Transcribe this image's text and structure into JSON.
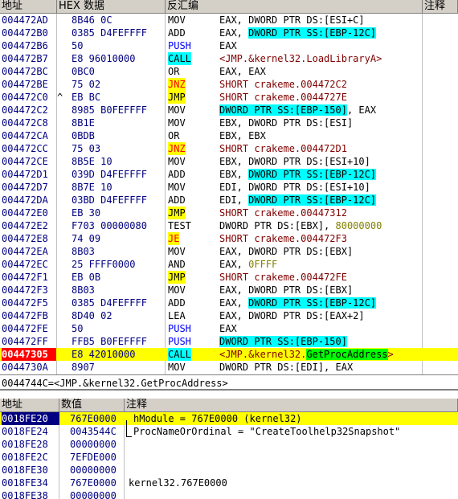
{
  "cpu": {
    "headers": {
      "address": "地址",
      "hex": "HEX 数据",
      "disasm": "反汇编",
      "comment": "注释"
    },
    "rows": [
      {
        "addr": "004472AD",
        "mark": "",
        "hex": "8B46 0C",
        "mn": "MOV",
        "op": [
          {
            "t": "EAX, DWORD PTR DS:[ESI+C]"
          }
        ]
      },
      {
        "addr": "004472B0",
        "mark": "",
        "hex": "0385 D4FEFFFF",
        "mn": "ADD",
        "op": [
          {
            "t": "EAX, "
          },
          {
            "t": "DWORD PTR SS:[EBP-12C]",
            "c": "cy"
          }
        ]
      },
      {
        "addr": "004472B6",
        "mark": "",
        "hex": "50",
        "mn": "PUSH",
        "mnc": "push",
        "op": [
          {
            "t": "EAX"
          }
        ]
      },
      {
        "addr": "004472B7",
        "mark": "",
        "hex": "E8 96010000",
        "mn": "CALL",
        "mnc": "call",
        "op": [
          {
            "t": "<JMP.&kernel32.LoadLibraryA>",
            "c": "op-call"
          }
        ]
      },
      {
        "addr": "004472BC",
        "mark": "",
        "hex": "0BC0",
        "mn": "OR",
        "op": [
          {
            "t": "EAX, EAX"
          }
        ]
      },
      {
        "addr": "004472BE",
        "mark": "",
        "hex": "75 02",
        "mn": "JNZ",
        "mnc": "jcc",
        "op": [
          {
            "t": "SHORT crakeme.004472C2",
            "c": "op-jmp"
          }
        ]
      },
      {
        "addr": "004472C0",
        "mark": "^",
        "hex": "EB BC",
        "mn": "JMP",
        "mnc": "jmp",
        "op": [
          {
            "t": "SHORT crakeme.0044727E",
            "c": "op-jmp"
          }
        ]
      },
      {
        "addr": "004472C2",
        "mark": "",
        "hex": "8985 B0FEFFFF",
        "mn": "MOV",
        "op": [
          {
            "t": "DWORD PTR SS:[EBP-150]",
            "c": "cy"
          },
          {
            "t": ", EAX"
          }
        ]
      },
      {
        "addr": "004472C8",
        "mark": "",
        "hex": "8B1E",
        "mn": "MOV",
        "op": [
          {
            "t": "EBX, DWORD PTR DS:[ESI]"
          }
        ]
      },
      {
        "addr": "004472CA",
        "mark": "",
        "hex": "0BDB",
        "mn": "OR",
        "op": [
          {
            "t": "EBX, EBX"
          }
        ]
      },
      {
        "addr": "004472CC",
        "mark": "",
        "hex": "75 03",
        "mn": "JNZ",
        "mnc": "jcc",
        "op": [
          {
            "t": "SHORT crakeme.004472D1",
            "c": "op-jmp"
          }
        ]
      },
      {
        "addr": "004472CE",
        "mark": "",
        "hex": "8B5E 10",
        "mn": "MOV",
        "op": [
          {
            "t": "EBX, DWORD PTR DS:[ESI+10]"
          }
        ]
      },
      {
        "addr": "004472D1",
        "mark": "",
        "hex": "039D D4FEFFFF",
        "mn": "ADD",
        "op": [
          {
            "t": "EBX, "
          },
          {
            "t": "DWORD PTR SS:[EBP-12C]",
            "c": "cy"
          }
        ]
      },
      {
        "addr": "004472D7",
        "mark": "",
        "hex": "8B7E 10",
        "mn": "MOV",
        "op": [
          {
            "t": "EDI, DWORD PTR DS:[ESI+10]"
          }
        ]
      },
      {
        "addr": "004472DA",
        "mark": "",
        "hex": "03BD D4FEFFFF",
        "mn": "ADD",
        "op": [
          {
            "t": "EDI, "
          },
          {
            "t": "DWORD PTR SS:[EBP-12C]",
            "c": "cy"
          }
        ]
      },
      {
        "addr": "004472E0",
        "mark": "",
        "hex": "EB 30",
        "mn": "JMP",
        "mnc": "jmp",
        "op": [
          {
            "t": "SHORT crakeme.00447312",
            "c": "op-jmp"
          }
        ]
      },
      {
        "addr": "004472E2",
        "mark": "",
        "hex": "F703 00000080",
        "mn": "TEST",
        "op": [
          {
            "t": "DWORD PTR DS:[EBX], "
          },
          {
            "t": "80000000",
            "c": "olive"
          }
        ]
      },
      {
        "addr": "004472E8",
        "mark": "",
        "hex": "74 09",
        "mn": "JE",
        "mnc": "jcc",
        "op": [
          {
            "t": "SHORT crakeme.004472F3",
            "c": "op-jmp"
          }
        ]
      },
      {
        "addr": "004472EA",
        "mark": "",
        "hex": "8B03",
        "mn": "MOV",
        "op": [
          {
            "t": "EAX, DWORD PTR DS:[EBX]"
          }
        ]
      },
      {
        "addr": "004472EC",
        "mark": "",
        "hex": "25 FFFF0000",
        "mn": "AND",
        "op": [
          {
            "t": "EAX, "
          },
          {
            "t": "0FFFF",
            "c": "olive"
          }
        ]
      },
      {
        "addr": "004472F1",
        "mark": "",
        "hex": "EB 0B",
        "mn": "JMP",
        "mnc": "jmp",
        "op": [
          {
            "t": "SHORT crakeme.004472FE",
            "c": "op-jmp"
          }
        ]
      },
      {
        "addr": "004472F3",
        "mark": "",
        "hex": "8B03",
        "mn": "MOV",
        "op": [
          {
            "t": "EAX, DWORD PTR DS:[EBX]"
          }
        ]
      },
      {
        "addr": "004472F5",
        "mark": "",
        "hex": "0385 D4FEFFFF",
        "mn": "ADD",
        "op": [
          {
            "t": "EAX, "
          },
          {
            "t": "DWORD PTR SS:[EBP-12C]",
            "c": "cy"
          }
        ]
      },
      {
        "addr": "004472FB",
        "mark": "",
        "hex": "8D40 02",
        "mn": "LEA",
        "op": [
          {
            "t": "EAX, DWORD PTR DS:[EAX+2]"
          }
        ]
      },
      {
        "addr": "004472FE",
        "mark": "",
        "hex": "50",
        "mn": "PUSH",
        "mnc": "push",
        "op": [
          {
            "t": "EAX"
          }
        ]
      },
      {
        "addr": "004472FF",
        "mark": "",
        "hex": "FFB5 B0FEFFFF",
        "mn": "PUSH",
        "mnc": "push",
        "op": [
          {
            "t": "DWORD PTR SS:[EBP-150]",
            "c": "cy"
          }
        ]
      },
      {
        "addr": "00447305",
        "mark": "",
        "hex": "E8 42010000",
        "mn": "CALL",
        "mnc": "call",
        "sel": true,
        "op": [
          {
            "t": "<JMP.&kernel32.",
            "c": "op-call"
          },
          {
            "t": "GetProcAddress",
            "c": "gr"
          },
          {
            "t": ">",
            "c": "op-call"
          }
        ]
      },
      {
        "addr": "0044730A",
        "mark": "",
        "hex": "8907",
        "mn": "MOV",
        "op": [
          {
            "t": "DWORD PTR DS:[EDI], EAX"
          }
        ]
      }
    ]
  },
  "info_line": "0044744C=<JMP.&kernel32.GetProcAddress>",
  "stack": {
    "headers": {
      "address": "地址",
      "value": "数值",
      "comment": "注释"
    },
    "rows": [
      {
        "addr": "0018FE20",
        "val": "767E0000",
        "cm": "hModule = 767E0000 (kernel32)",
        "sel": true
      },
      {
        "addr": "0018FE24",
        "val": "0043544C",
        "cm": "ProcNameOrOrdinal = \"CreateToolhelp32Snapshot\""
      },
      {
        "addr": "0018FE28",
        "val": "00000000",
        "cm": ""
      },
      {
        "addr": "0018FE2C",
        "val": "7EFDE000",
        "cm": ""
      },
      {
        "addr": "0018FE30",
        "val": "00000000",
        "cm": ""
      },
      {
        "addr": "0018FE34",
        "val": "767E0000",
        "cm": "kernel32.767E0000"
      },
      {
        "addr": "0018FE38",
        "val": "00000000",
        "cm": ""
      }
    ]
  },
  "colors": {
    "jump_highlight": "#ffff00",
    "memory_operand": "#00ffff",
    "api_name": "#00ff00",
    "eip_address": "#ff0000"
  }
}
